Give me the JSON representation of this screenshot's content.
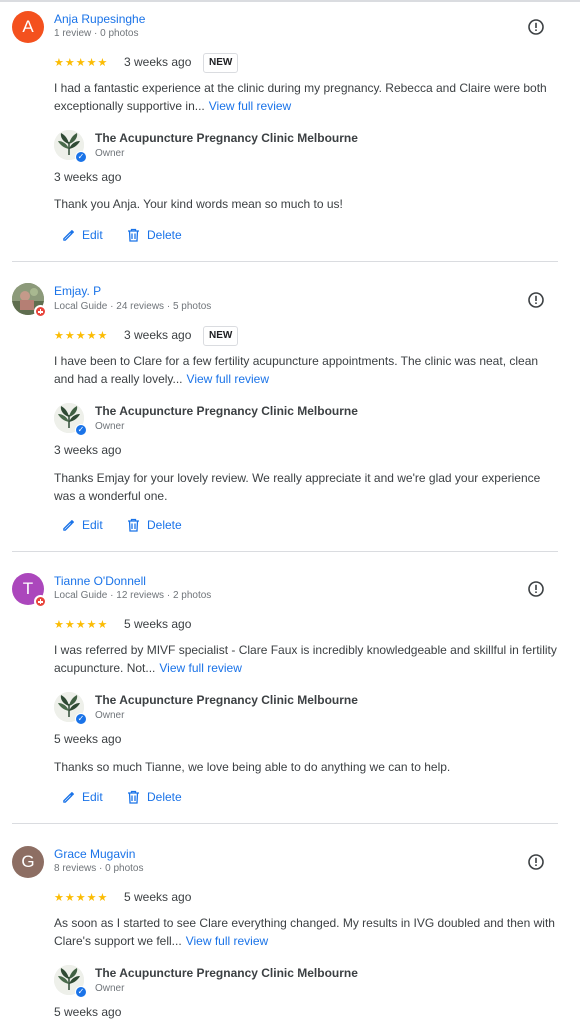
{
  "colors": {
    "accent": "#1a73e8",
    "star": "#fbbc04",
    "badge_guide": "#e8453c",
    "verified": "#1a73e8"
  },
  "icons": {
    "report": "report-icon",
    "edit": "pencil-icon",
    "delete": "trash-icon",
    "star": "star-icon",
    "verified": "verified-check-icon"
  },
  "actions": {
    "edit": "Edit",
    "delete": "Delete"
  },
  "reviews": [
    {
      "avatar_letter": "A",
      "avatar_color": "#f4511e",
      "name": "Anja Rupesinghe",
      "meta": "1 review · 0 photos",
      "rating": 5,
      "stars": "★★★★★",
      "when": "3 weeks ago",
      "badge": "NEW",
      "text": "I had a fantastic experience at the clinic during my pregnancy. Rebecca and Claire were both exceptionally supportive in...",
      "more": "View full review",
      "reply": {
        "business": "The Acupuncture Pregnancy Clinic Melbourne",
        "role": "Owner",
        "when": "3 weeks ago",
        "text": "Thank you Anja. Your kind words mean so much to us!"
      }
    },
    {
      "avatar_letter": "",
      "avatar_color": "#7a8a6a",
      "name": "Emjay. P",
      "meta": "Local Guide · 24 reviews · 5 photos",
      "rating": 5,
      "stars": "★★★★★",
      "when": "3 weeks ago",
      "badge": "NEW",
      "text": "I have been to Clare for a few fertility acupuncture appointments. The clinic was neat, clean and had a really lovely...",
      "more": "View full review",
      "reply": {
        "business": "The Acupuncture Pregnancy Clinic Melbourne",
        "role": "Owner",
        "when": "3 weeks ago",
        "text": "Thanks Emjay for your lovely review. We really appreciate it and we're glad your experience was a wonderful one."
      }
    },
    {
      "avatar_letter": "T",
      "avatar_color": "#ab47bc",
      "name": "Tianne O'Donnell",
      "meta": "Local Guide · 12 reviews · 2 photos",
      "rating": 5,
      "stars": "★★★★★",
      "when": "5 weeks ago",
      "badge": "",
      "text": "I was referred by MIVF specialist - Clare Faux is incredibly knowledgeable and skillful in fertility acupuncture. Not...",
      "more": "View full review",
      "reply": {
        "business": "The Acupuncture Pregnancy Clinic Melbourne",
        "role": "Owner",
        "when": "5 weeks ago",
        "text": "Thanks so much Tianne, we love being able to do anything we can to help."
      }
    },
    {
      "avatar_letter": "G",
      "avatar_color": "#8d6e63",
      "name": "Grace Mugavin",
      "meta": "8 reviews · 0 photos",
      "rating": 5,
      "stars": "★★★★★",
      "when": "5 weeks ago",
      "badge": "",
      "text": "As soon as I started to see Clare everything changed. My results in IVG doubled and then with Clare's support we fell...",
      "more": "View full review",
      "reply": {
        "business": "The Acupuncture Pregnancy Clinic Melbourne",
        "role": "Owner",
        "when": "5 weeks ago",
        "text": ""
      }
    }
  ]
}
